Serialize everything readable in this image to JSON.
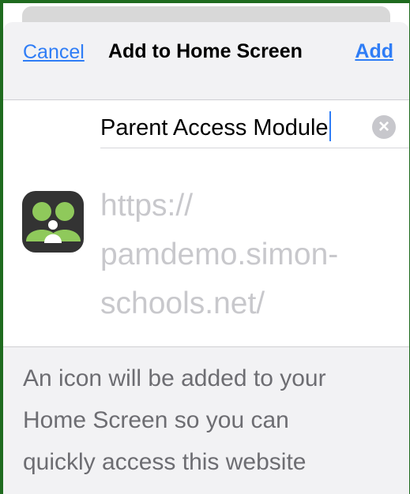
{
  "header": {
    "cancel_label": "Cancel",
    "title": "Add to Home Screen",
    "add_label": "Add"
  },
  "name_field": {
    "value": "Parent Access Module",
    "clear_icon": "clear-circle-icon"
  },
  "site": {
    "icon": "parent-access-module-app-icon",
    "url_line1": "https://",
    "url_line2": "pamdemo.simon-",
    "url_line3": "schools.net/"
  },
  "footer": {
    "line1": "An icon will be added to your",
    "line2": "Home Screen so you can",
    "line3": "quickly access this website"
  },
  "colors": {
    "accent": "#2f7df6",
    "nav_background": "#f2f2f4",
    "icon_green": "#8fc95b",
    "icon_background": "#333333",
    "frame_green": "#1f6b1f"
  }
}
